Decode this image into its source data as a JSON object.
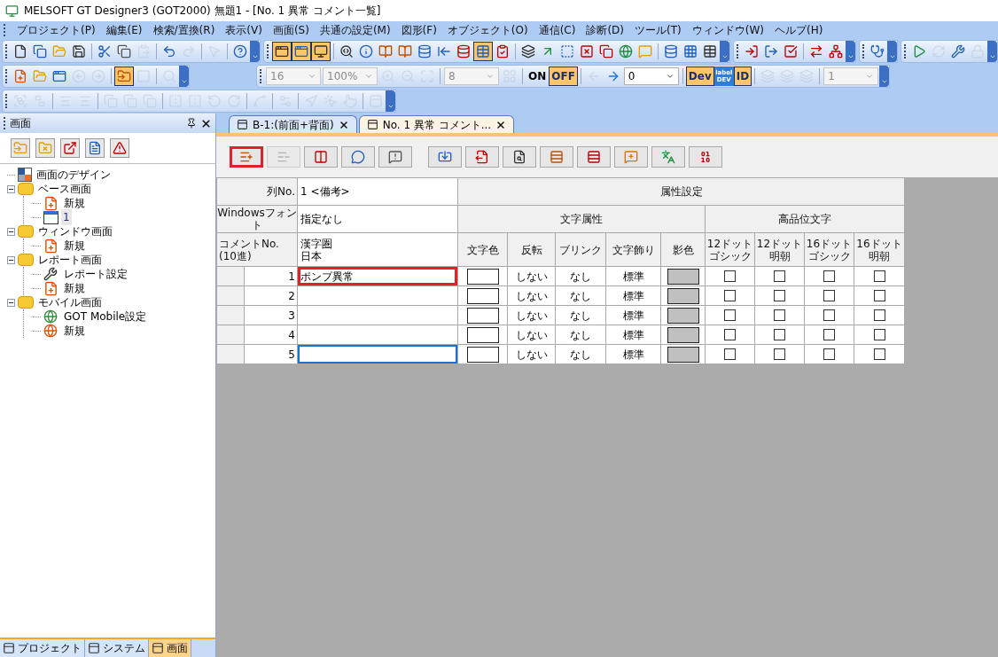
{
  "window": {
    "title": "MELSOFT GT Designer3 (GOT2000) 無題1 - [No. 1 異常 コメント一覧]"
  },
  "menu": [
    "プロジェクト(P)",
    "編集(E)",
    "検索/置換(R)",
    "表示(V)",
    "画面(S)",
    "共通の設定(M)",
    "図形(F)",
    "オブジェクト(O)",
    "通信(C)",
    "診断(D)",
    "ツール(T)",
    "ウィンドウ(W)",
    "ヘルプ(H)"
  ],
  "toolbar_rows": [
    [
      {
        "items": [
          {
            "kind": "button",
            "active": false,
            "disabled": false
          },
          {
            "kind": "button",
            "active": false,
            "disabled": false
          },
          {
            "kind": "button",
            "active": false,
            "disabled": false
          },
          {
            "kind": "button",
            "active": false,
            "disabled": false
          },
          {
            "kind": "separator"
          },
          {
            "kind": "button",
            "active": false,
            "disabled": false
          },
          {
            "kind": "button",
            "active": false,
            "disabled": false
          },
          {
            "kind": "button",
            "active": false,
            "disabled": true
          },
          {
            "kind": "separator"
          },
          {
            "kind": "button",
            "active": false,
            "disabled": false
          },
          {
            "kind": "button",
            "active": false,
            "disabled": true
          },
          {
            "kind": "separator"
          },
          {
            "kind": "button",
            "active": false,
            "disabled": true
          },
          {
            "kind": "separator"
          },
          {
            "kind": "button",
            "active": false,
            "disabled": false
          }
        ]
      },
      {
        "items": [
          {
            "kind": "button",
            "active": true,
            "disabled": false
          },
          {
            "kind": "button",
            "active": true,
            "disabled": false
          },
          {
            "kind": "button",
            "active": true,
            "disabled": false
          },
          {
            "kind": "separator"
          },
          {
            "kind": "button",
            "active": false,
            "disabled": false
          },
          {
            "kind": "button",
            "active": false,
            "disabled": false
          },
          {
            "kind": "button",
            "active": false,
            "disabled": false
          },
          {
            "kind": "button",
            "active": false,
            "disabled": false
          },
          {
            "kind": "button",
            "active": false,
            "disabled": false
          },
          {
            "kind": "button",
            "active": false,
            "disabled": false
          },
          {
            "kind": "button",
            "active": false,
            "disabled": false
          },
          {
            "kind": "button",
            "active": true,
            "disabled": false
          },
          {
            "kind": "button",
            "active": false,
            "disabled": false
          },
          {
            "kind": "separator"
          },
          {
            "kind": "button",
            "active": false,
            "disabled": false
          },
          {
            "kind": "button",
            "active": false,
            "disabled": false
          },
          {
            "kind": "button",
            "active": false,
            "disabled": false
          },
          {
            "kind": "button",
            "active": false,
            "disabled": false
          },
          {
            "kind": "button",
            "active": false,
            "disabled": false
          },
          {
            "kind": "button",
            "active": false,
            "disabled": false
          },
          {
            "kind": "button",
            "active": false,
            "disabled": false
          },
          {
            "kind": "separator"
          },
          {
            "kind": "button",
            "active": false,
            "disabled": false
          },
          {
            "kind": "button",
            "active": false,
            "disabled": false
          },
          {
            "kind": "button",
            "active": false,
            "disabled": false
          }
        ]
      },
      {
        "items": [
          {
            "kind": "button",
            "active": false,
            "disabled": false
          },
          {
            "kind": "button",
            "active": false,
            "disabled": false
          },
          {
            "kind": "button",
            "active": false,
            "disabled": false
          },
          {
            "kind": "separator"
          },
          {
            "kind": "button",
            "active": false,
            "disabled": false
          },
          {
            "kind": "button",
            "active": false,
            "disabled": false
          }
        ]
      },
      {
        "items": [
          {
            "kind": "button",
            "active": false,
            "disabled": false
          }
        ]
      },
      {
        "items": [
          {
            "kind": "button",
            "active": false,
            "disabled": false
          },
          {
            "kind": "button",
            "active": false,
            "disabled": true
          },
          {
            "kind": "button",
            "active": false,
            "disabled": false
          },
          {
            "kind": "button",
            "active": false,
            "disabled": true
          }
        ]
      }
    ],
    [
      {
        "items": [
          {
            "kind": "button",
            "active": false,
            "disabled": false
          },
          {
            "kind": "button",
            "active": false,
            "disabled": false
          },
          {
            "kind": "button",
            "active": false,
            "disabled": false
          },
          {
            "kind": "button",
            "active": false,
            "disabled": true
          },
          {
            "kind": "button",
            "active": false,
            "disabled": true
          },
          {
            "kind": "separator"
          },
          {
            "kind": "button",
            "active": true,
            "disabled": false
          },
          {
            "kind": "button",
            "active": false,
            "disabled": true
          },
          {
            "kind": "separator"
          },
          {
            "kind": "button",
            "active": false,
            "disabled": true
          }
        ]
      },
      {
        "items": [
          {
            "kind": "combo",
            "value": "16",
            "disabled": true
          },
          {
            "kind": "combo",
            "value": "100%",
            "disabled": true
          },
          {
            "kind": "button",
            "active": false,
            "disabled": true
          },
          {
            "kind": "button",
            "active": false,
            "disabled": true
          },
          {
            "kind": "button",
            "active": false,
            "disabled": true
          },
          {
            "kind": "separator"
          },
          {
            "kind": "combo",
            "value": "8",
            "disabled": true
          },
          {
            "kind": "button",
            "active": false,
            "disabled": true
          },
          {
            "kind": "separator"
          },
          {
            "kind": "text-button",
            "label": "ON",
            "active": false
          },
          {
            "kind": "text-button",
            "label": "OFF",
            "active": true
          },
          {
            "kind": "separator"
          },
          {
            "kind": "button",
            "active": false,
            "disabled": true
          },
          {
            "kind": "button",
            "active": false,
            "disabled": false
          },
          {
            "kind": "combo",
            "value": "0",
            "disabled": false
          },
          {
            "kind": "separator"
          },
          {
            "kind": "text-button",
            "label": "Dev",
            "active": true
          },
          {
            "kind": "stacked-text",
            "lines": [
              "label",
              "DEV"
            ]
          },
          {
            "kind": "text-button",
            "label": "ID",
            "active": true
          },
          {
            "kind": "separator"
          },
          {
            "kind": "button",
            "active": false,
            "disabled": true
          },
          {
            "kind": "button",
            "active": false,
            "disabled": true
          },
          {
            "kind": "button",
            "active": false,
            "disabled": true
          },
          {
            "kind": "separator"
          },
          {
            "kind": "combo",
            "value": "1",
            "disabled": true
          }
        ]
      }
    ],
    [
      {
        "items": [
          {
            "kind": "button",
            "active": false,
            "disabled": true
          },
          {
            "kind": "button",
            "active": false,
            "disabled": true
          },
          {
            "kind": "separator"
          },
          {
            "kind": "button",
            "active": false,
            "disabled": true
          },
          {
            "kind": "button",
            "active": false,
            "disabled": true
          },
          {
            "kind": "separator"
          },
          {
            "kind": "button",
            "active": false,
            "disabled": true
          },
          {
            "kind": "button",
            "active": false,
            "disabled": true
          },
          {
            "kind": "button",
            "active": false,
            "disabled": true
          },
          {
            "kind": "separator"
          },
          {
            "kind": "button",
            "active": false,
            "disabled": true
          },
          {
            "kind": "button",
            "active": false,
            "disabled": true
          },
          {
            "kind": "button",
            "active": false,
            "disabled": true
          },
          {
            "kind": "button",
            "active": false,
            "disabled": true
          },
          {
            "kind": "separator"
          },
          {
            "kind": "button",
            "active": false,
            "disabled": true
          },
          {
            "kind": "separator"
          },
          {
            "kind": "button",
            "active": false,
            "disabled": true
          },
          {
            "kind": "separator"
          },
          {
            "kind": "button",
            "active": false,
            "disabled": true
          },
          {
            "kind": "button",
            "active": false,
            "disabled": true
          },
          {
            "kind": "button",
            "active": false,
            "disabled": true
          },
          {
            "kind": "separator"
          },
          {
            "kind": "button",
            "active": false,
            "disabled": true
          }
        ]
      }
    ]
  ],
  "left_panel": {
    "title": "画面",
    "tools": [
      {
        "disabled": false
      },
      {
        "disabled": false
      },
      {
        "disabled": false
      },
      {
        "disabled": false
      },
      {
        "disabled": false
      }
    ],
    "tree": [
      {
        "label": "画面のデザイン",
        "kind": "design",
        "selected": false
      },
      {
        "label": "ベース画面",
        "kind": "folder",
        "expanded": true,
        "selected": false,
        "children": [
          {
            "label": "新規",
            "kind": "new",
            "selected": false
          },
          {
            "label": "1",
            "kind": "screen",
            "selected": true
          }
        ]
      },
      {
        "label": "ウィンドウ画面",
        "kind": "folder",
        "expanded": true,
        "selected": false,
        "children": [
          {
            "label": "新規",
            "kind": "new",
            "selected": false
          }
        ]
      },
      {
        "label": "レポート画面",
        "kind": "folder",
        "expanded": true,
        "selected": false,
        "children": [
          {
            "label": "レポート設定",
            "kind": "report-settings",
            "selected": false
          },
          {
            "label": "新規",
            "kind": "report-new",
            "selected": false
          }
        ]
      },
      {
        "label": "モバイル画面",
        "kind": "folder",
        "expanded": true,
        "selected": false,
        "children": [
          {
            "label": "GOT Mobile設定",
            "kind": "mobile-settings",
            "selected": false
          },
          {
            "label": "新規",
            "kind": "mobile-new",
            "selected": false
          }
        ]
      }
    ],
    "bottom_tabs": [
      {
        "label": "プロジェクト",
        "selected": false
      },
      {
        "label": "システム",
        "selected": false
      },
      {
        "label": "画面",
        "selected": true
      }
    ]
  },
  "doc_tabs": [
    {
      "label": "B-1:(前面+背面)",
      "selected": false
    },
    {
      "label": "No. 1 異常 コメント...",
      "selected": true
    }
  ],
  "comment_toolbar": [
    {
      "highlighted": true,
      "disabled": false
    },
    {
      "highlighted": false,
      "disabled": true
    },
    {
      "highlighted": false,
      "disabled": false
    },
    {
      "highlighted": false,
      "disabled": false
    },
    {
      "highlighted": false,
      "disabled": false
    },
    {
      "highlighted": false,
      "disabled": false
    },
    {
      "highlighted": false,
      "disabled": false
    },
    {
      "highlighted": false,
      "disabled": false
    },
    {
      "highlighted": false,
      "disabled": false
    },
    {
      "highlighted": false,
      "disabled": false
    },
    {
      "highlighted": false,
      "disabled": false
    },
    {
      "highlighted": false,
      "disabled": false
    },
    {
      "highlighted": false,
      "disabled": false
    }
  ],
  "table": {
    "column_no_label": "列No.",
    "column_no_value": "1 <備考>",
    "attributes_header": "属性設定",
    "font_label": "Windowsフォント",
    "font_value": "指定なし",
    "char_attr_header": "文字属性",
    "hq_header": "高品位文字",
    "comment_no_header": "コメントNo.\n(10進)",
    "language_header": [
      "漢字圏",
      "日本"
    ],
    "columns": [
      [
        "文字色"
      ],
      [
        "反転"
      ],
      [
        "ブリンク"
      ],
      [
        "文字飾り"
      ],
      [
        "影色"
      ],
      [
        "12ドット",
        "ゴシック"
      ],
      [
        "12ドット",
        "明朝"
      ],
      [
        "16ドット",
        "ゴシック"
      ],
      [
        "16ドット",
        "明朝"
      ]
    ],
    "rows": [
      {
        "no": "1",
        "text": "ポンプ異常",
        "highlighted": true,
        "focused": false,
        "reverse": "しない",
        "blink": "なし",
        "decoration": "標準",
        "checks": [
          false,
          false,
          false,
          false
        ]
      },
      {
        "no": "2",
        "highlighted": false,
        "focused": false,
        "reverse": "しない",
        "blink": "なし",
        "decoration": "標準",
        "checks": [
          false,
          false,
          false,
          false
        ]
      },
      {
        "no": "3",
        "highlighted": false,
        "focused": false,
        "reverse": "しない",
        "blink": "なし",
        "decoration": "標準",
        "checks": [
          false,
          false,
          false,
          false
        ]
      },
      {
        "no": "4",
        "highlighted": false,
        "focused": false,
        "reverse": "しない",
        "blink": "なし",
        "decoration": "標準",
        "checks": [
          false,
          false,
          false,
          false
        ]
      },
      {
        "no": "5",
        "highlighted": false,
        "focused": true,
        "reverse": "しない",
        "blink": "なし",
        "decoration": "標準",
        "checks": [
          false,
          false,
          false,
          false
        ]
      }
    ]
  }
}
